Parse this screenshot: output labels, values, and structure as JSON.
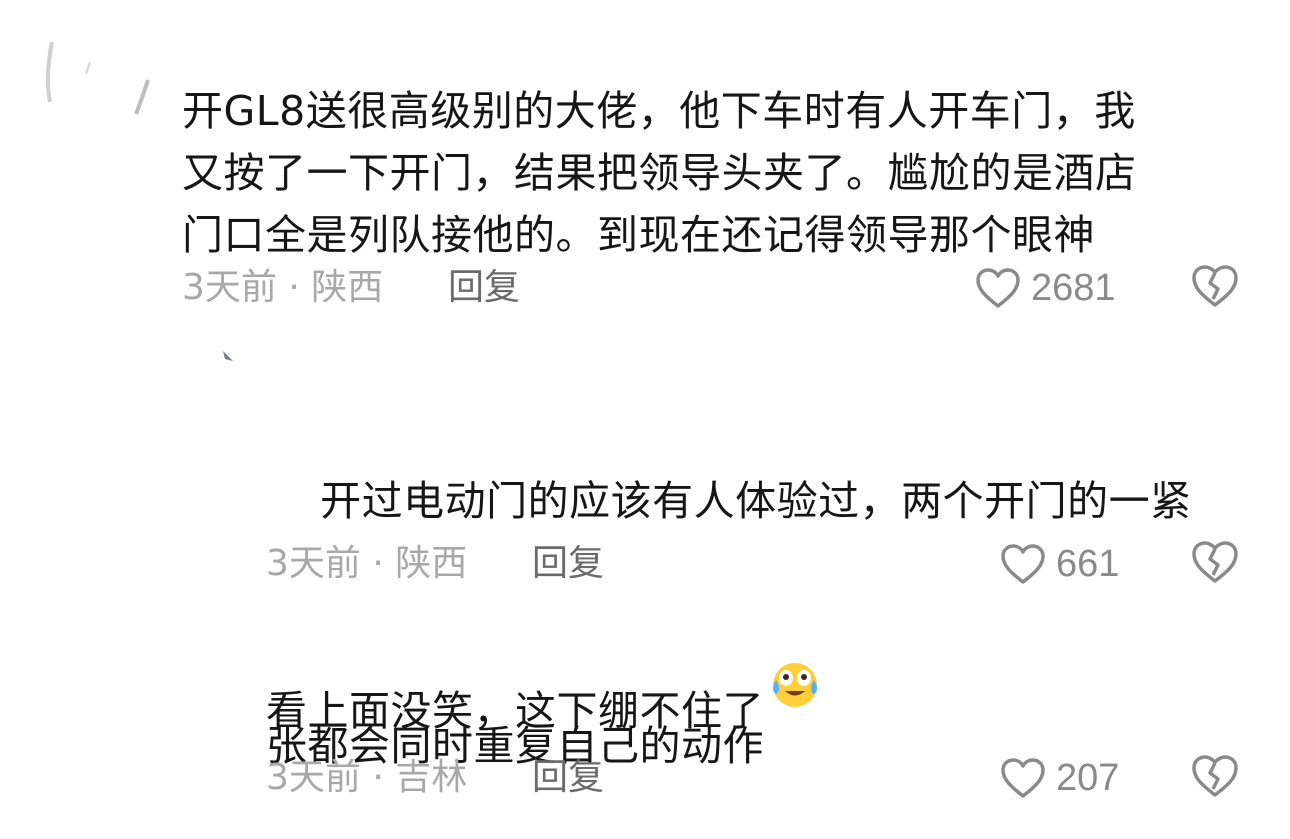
{
  "comments": [
    {
      "text": "开GL8送很高级别的大佬，他下车时有人开车门，我\n又按了一下开门，结果把领导头夹了。尴尬的是酒店\n门口全是列队接他的。到现在还记得领导那个眼神",
      "time": "3天前",
      "separator": "·",
      "location": "陕西",
      "reply_label": "回复",
      "likes": "2681"
    },
    {
      "text": "开过电动门的应该有人体验过，两个开门的一紧\n张都会同时重复自己的动作",
      "emoji": "crying-laughing-emoji",
      "time": "3天前",
      "separator": "·",
      "location": "陕西",
      "reply_label": "回复",
      "likes": "661"
    },
    {
      "text": "看上面没笑，这下绷不住了",
      "time": "3天前",
      "separator": "·",
      "location": "吉林",
      "reply_label": "回复",
      "likes": "207"
    }
  ],
  "colors": {
    "text": "#161616",
    "meta": "#a8a8a8",
    "reply": "#6b6b6b",
    "icon": "#8a8a8a"
  }
}
